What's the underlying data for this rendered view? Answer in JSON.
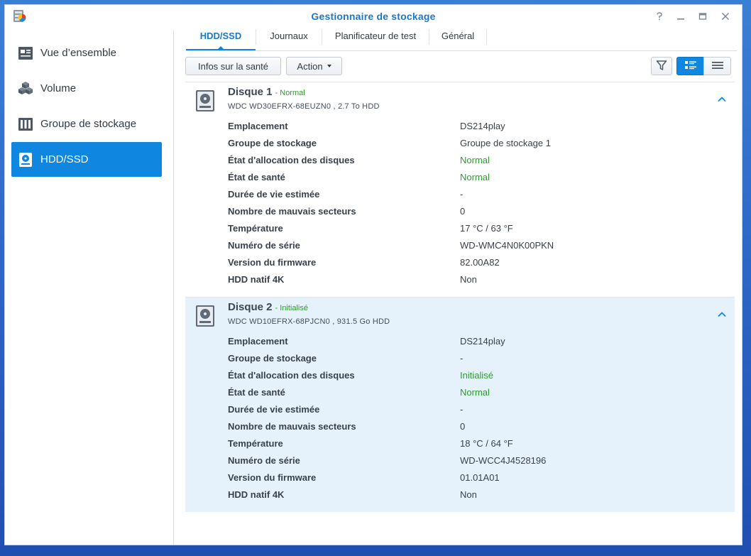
{
  "window": {
    "title": "Gestionnaire de stockage",
    "controls": [
      "help-icon",
      "minimize-icon",
      "maximize-icon",
      "close-icon"
    ]
  },
  "sidebar": {
    "items": [
      {
        "label": "Vue d’ensemble",
        "icon": "overview-icon",
        "active": false
      },
      {
        "label": "Volume",
        "icon": "volume-icon",
        "active": false
      },
      {
        "label": "Groupe de stockage",
        "icon": "storage-pool-icon",
        "active": false
      },
      {
        "label": "HDD/SSD",
        "icon": "hdd-icon",
        "active": true
      }
    ]
  },
  "tabs": [
    {
      "label": "HDD/SSD",
      "active": true
    },
    {
      "label": "Journaux",
      "active": false
    },
    {
      "label": "Planificateur de test",
      "active": false
    },
    {
      "label": "Général",
      "active": false
    }
  ],
  "toolbar": {
    "health_label": "Infos sur la santé",
    "action_label": "Action",
    "filter_icon": "filter-icon",
    "view_detail_icon": "detail-view-icon",
    "view_list_icon": "list-view-icon"
  },
  "disks": [
    {
      "name": "Disque 1",
      "status": "- Normal",
      "model": "WDC WD30EFRX-68EUZN0 , 2.7 To HDD",
      "fields": [
        {
          "key": "Emplacement",
          "value": "DS214play"
        },
        {
          "key": "Groupe de stockage",
          "value": "Groupe de stockage 1"
        },
        {
          "key": "État d'allocation des disques",
          "value": "Normal"
        },
        {
          "key": "État de santé",
          "value": "Normal"
        },
        {
          "key": "Durée de vie estimée",
          "value": "-"
        },
        {
          "key": "Nombre de mauvais secteurs",
          "value": "0"
        },
        {
          "key": "Température",
          "value": "17 °C / 63 °F"
        },
        {
          "key": "Numéro de série",
          "value": "WD-WMC4N0K00PKN"
        },
        {
          "key": "Version du firmware",
          "value": "82.00A82"
        },
        {
          "key": "HDD natif 4K",
          "value": "Non"
        }
      ]
    },
    {
      "name": "Disque 2",
      "status": "- Initialisé",
      "model": "WDC WD10EFRX-68PJCN0 , 931.5 Go HDD",
      "fields": [
        {
          "key": "Emplacement",
          "value": "DS214play"
        },
        {
          "key": "Groupe de stockage",
          "value": "-"
        },
        {
          "key": "État d'allocation des disques",
          "value": "Initialisé"
        },
        {
          "key": "État de santé",
          "value": "Normal"
        },
        {
          "key": "Durée de vie estimée",
          "value": "-"
        },
        {
          "key": "Nombre de mauvais secteurs",
          "value": "0"
        },
        {
          "key": "Température",
          "value": "18 °C / 64 °F"
        },
        {
          "key": "Numéro de série",
          "value": "WD-WCC4J4528196"
        },
        {
          "key": "Version du firmware",
          "value": "01.01A01"
        },
        {
          "key": "HDD natif 4K",
          "value": "Non"
        }
      ]
    }
  ],
  "colors": {
    "accent": "#0f86df",
    "status_ok": "#2e9b2e",
    "title": "#1b78c9",
    "selected_panel": "#e5f2fc"
  }
}
